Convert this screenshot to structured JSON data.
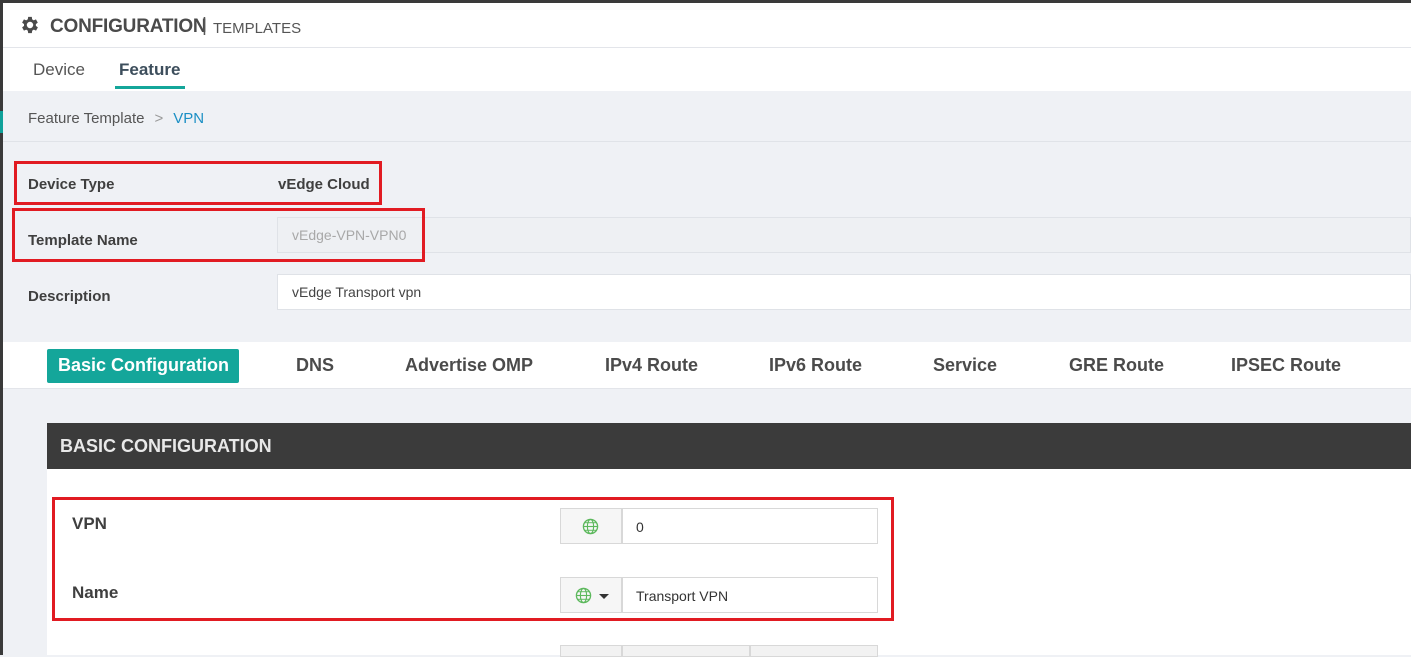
{
  "header": {
    "title": "CONFIGURATION",
    "separator": "|",
    "subtitle": "TEMPLATES"
  },
  "tabs": [
    {
      "label": "Device",
      "active": false
    },
    {
      "label": "Feature",
      "active": true
    }
  ],
  "breadcrumb": {
    "parent": "Feature Template",
    "separator": ">",
    "current": "VPN"
  },
  "form": {
    "device_type_label": "Device Type",
    "device_type_value": "vEdge Cloud",
    "template_name_label": "Template Name",
    "template_name_value": "vEdge-VPN-VPN0",
    "description_label": "Description",
    "description_value": "vEdge Transport vpn"
  },
  "subtabs": [
    {
      "label": "Basic Configuration",
      "active": true
    },
    {
      "label": "DNS"
    },
    {
      "label": "Advertise OMP"
    },
    {
      "label": "IPv4 Route"
    },
    {
      "label": "IPv6 Route"
    },
    {
      "label": "Service"
    },
    {
      "label": "GRE Route"
    },
    {
      "label": "IPSEC Route"
    }
  ],
  "basic": {
    "section_title": "BASIC CONFIGURATION",
    "vpn_label": "VPN",
    "vpn_value": "0",
    "name_label": "Name",
    "name_value": "Transport VPN"
  },
  "colors": {
    "accent": "#14a69a",
    "highlight": "#e11b22",
    "link": "#1b8fc4",
    "panel_header": "#3b3b3b"
  },
  "icons": {
    "settings": "gear-icon",
    "global_scope": "globe-icon",
    "dropdown": "chevron-down-icon"
  }
}
